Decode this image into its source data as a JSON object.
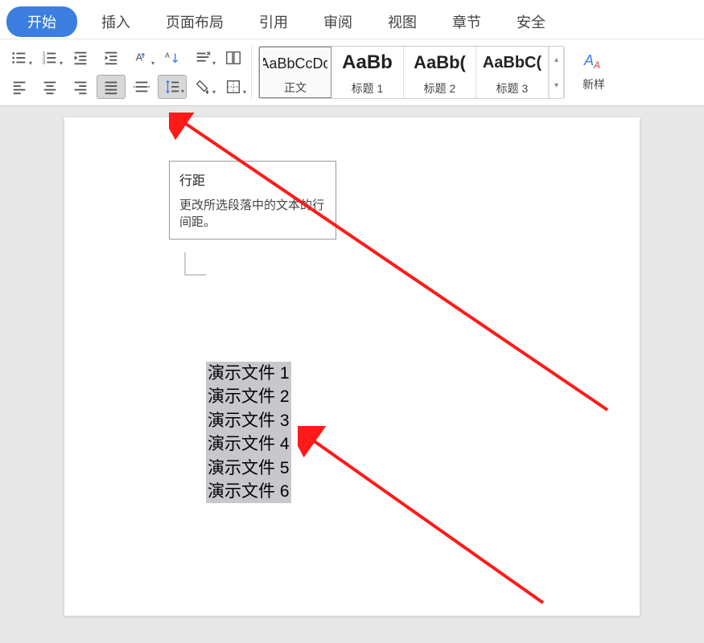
{
  "tabs": {
    "start": "开始",
    "insert": "插入",
    "pagelayout": "页面布局",
    "reference": "引用",
    "review": "审阅",
    "view": "视图",
    "chapter": "章节",
    "security": "安全"
  },
  "styles": {
    "normal": {
      "preview": "AaBbCcDd",
      "label": "正文"
    },
    "h1": {
      "preview": "AaBb",
      "label": "标题 1"
    },
    "h2": {
      "preview": "AaBb(",
      "label": "标题 2"
    },
    "h3": {
      "preview": "AaBbC(",
      "label": "标题 3"
    }
  },
  "newstyle_label": "新样",
  "tooltip": {
    "title": "行距",
    "desc": "更改所选段落中的文本的行间距。"
  },
  "doc_lines": [
    "演示文件 1",
    "演示文件 2",
    "演示文件 3",
    "演示文件 4",
    "演示文件 5",
    "演示文件 6"
  ]
}
